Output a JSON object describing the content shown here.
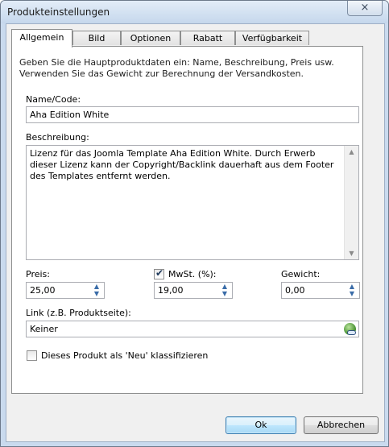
{
  "window": {
    "title": "Produkteinstellungen",
    "close_label": "×"
  },
  "tabs": [
    {
      "label": "Allgemein",
      "active": true
    },
    {
      "label": "Bild",
      "active": false
    },
    {
      "label": "Optionen",
      "active": false
    },
    {
      "label": "Rabatt",
      "active": false
    },
    {
      "label": "Verfügbarkeit",
      "active": false
    }
  ],
  "general": {
    "intro": "Geben Sie die Hauptproduktdaten ein: Name, Beschreibung, Preis usw. Verwenden Sie das Gewicht zur Berechnung der Versandkosten.",
    "name_label": "Name/Code:",
    "name_value": "Aha Edition White",
    "description_label": "Beschreibung:",
    "description_value": "Lizenz für das Joomla Template Aha Edition White. Durch Erwerb dieser Lizenz kann der Copyright/Backlink dauerhaft aus dem Footer des Templates entfernt werden.",
    "price_label": "Preis:",
    "price_value": "25,00",
    "vat_label": "MwSt. (%):",
    "vat_checked": true,
    "vat_value": "19,00",
    "weight_label": "Gewicht:",
    "weight_value": "0,00",
    "link_label": "Link (z.B. Produktseite):",
    "link_value": "Keiner",
    "new_label": "Dieses Produkt als 'Neu' klassifizieren",
    "new_checked": false
  },
  "footer": {
    "ok_label": "Ok",
    "cancel_label": "Abbrechen"
  }
}
